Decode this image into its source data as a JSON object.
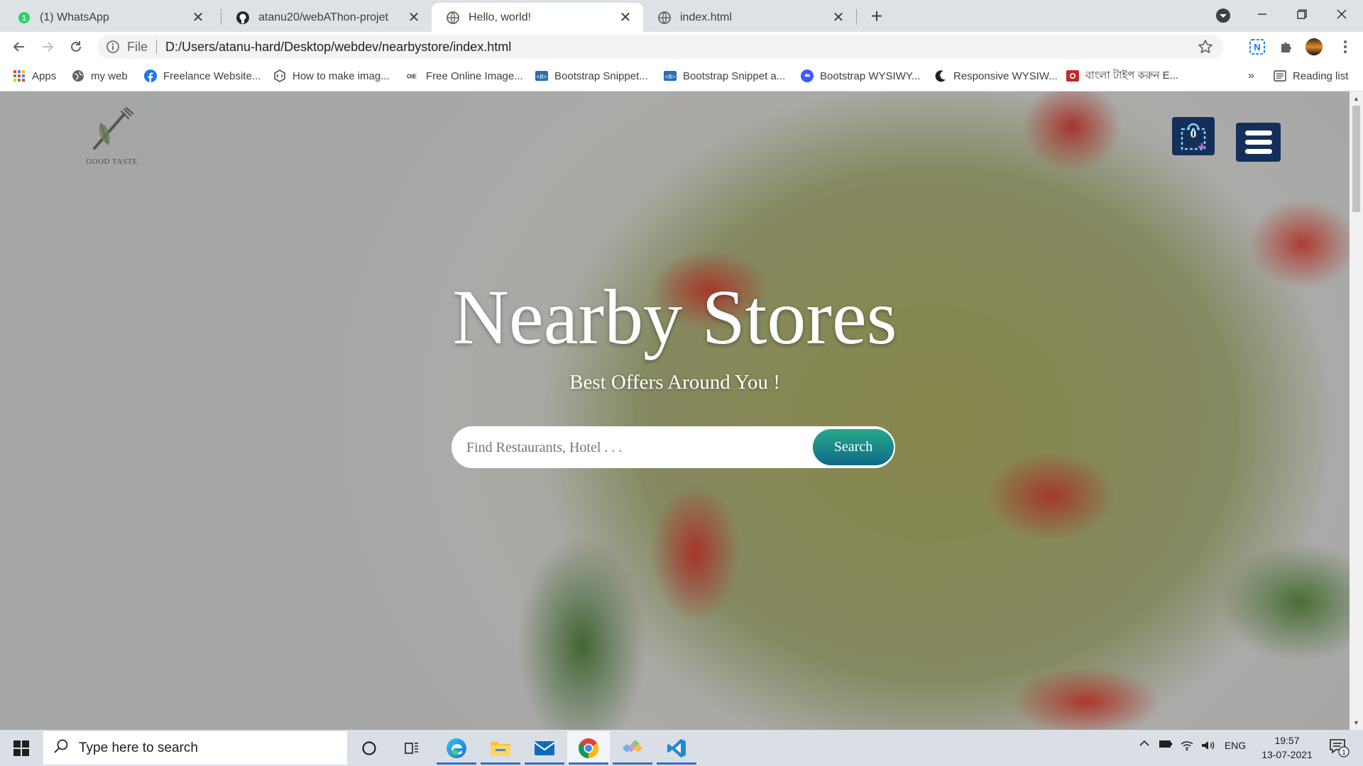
{
  "browser": {
    "tabs": [
      {
        "title": "(1) WhatsApp",
        "badge": "1"
      },
      {
        "title": "atanu20/webAThon-projet"
      },
      {
        "title": "Hello, world!"
      },
      {
        "title": "index.html"
      }
    ],
    "active_tab": 2,
    "address": {
      "scheme": "File",
      "url": "D:/Users/atanu-hard/Desktop/webdev/nearbystore/index.html"
    },
    "bookmarks": [
      "Apps",
      "my web",
      "Freelance Website...",
      "How to make imag...",
      "Free Online Image...",
      "Bootstrap Snippet...",
      "Bootstrap Snippet a...",
      "Bootstrap WYSIWY...",
      "Responsive WYSIW...",
      "বাংলা টাইপ করুন E..."
    ],
    "overflow_chevron": "»",
    "reading_list": "Reading list"
  },
  "page": {
    "logo_text": "GOOD TASTE",
    "cart_count": "0",
    "hero_title": "Nearby Stores",
    "hero_subtitle": "Best Offers Around You !",
    "search_placeholder": "Find Restaurants, Hotel . . .",
    "search_button": "Search"
  },
  "taskbar": {
    "search_placeholder": "Type here to search",
    "language": "ENG",
    "time": "19:57",
    "date": "13-07-2021",
    "notification_count": "1"
  },
  "colors": {
    "nav_button": "#14305a",
    "search_gradient_top": "#27a88a",
    "search_gradient_bottom": "#0e6a87",
    "taskbar": "#dadfe6"
  }
}
